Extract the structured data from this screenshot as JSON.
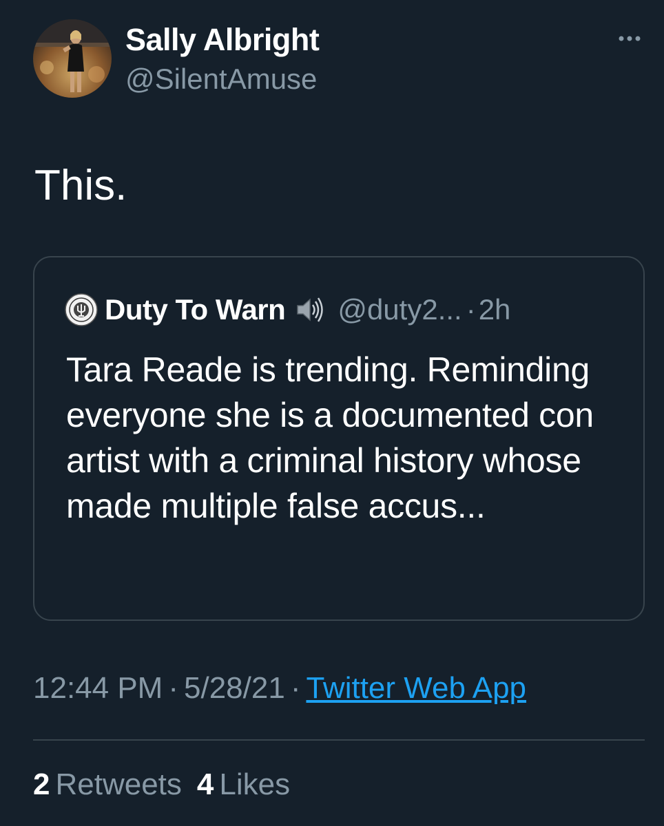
{
  "tweet": {
    "author": {
      "display_name": "Sally Albright",
      "handle": "@SilentAmuse"
    },
    "text": "This.",
    "more_icon": "more-horizontal-icon",
    "quoted": {
      "display_name": "Duty To Warn",
      "emoji_icon": "speaker-icon",
      "handle": "@duty2...",
      "separator": "·",
      "time": "2h",
      "text": "Tara Reade is trending. Reminding everyone she is a documented con artist with a criminal history whose made multiple false accus..."
    },
    "meta": {
      "time": "12:44 PM",
      "separator": "·",
      "date": "5/28/21",
      "source": "Twitter Web App"
    },
    "stats": {
      "retweets_count": "2",
      "retweets_label": "Retweets",
      "likes_count": "4",
      "likes_label": "Likes"
    }
  },
  "colors": {
    "background": "#15202b",
    "text_primary": "#ffffff",
    "text_secondary": "#8899a6",
    "link": "#1da1f2",
    "border": "#38444d"
  }
}
